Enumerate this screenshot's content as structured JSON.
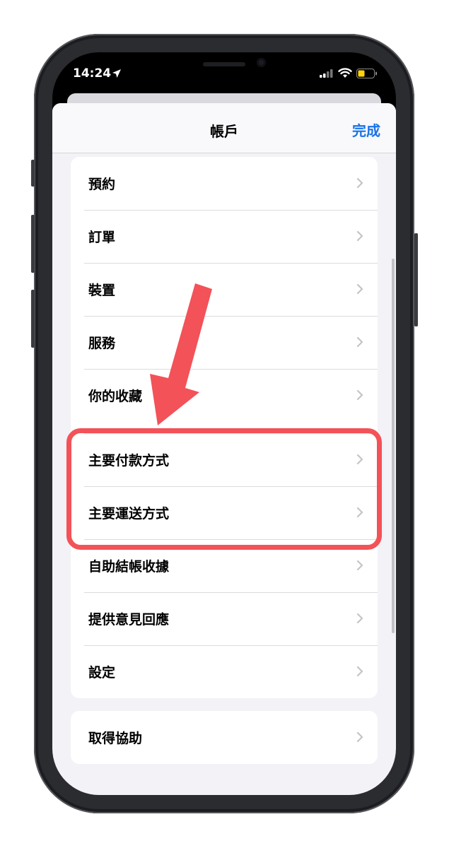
{
  "status": {
    "time": "14:24"
  },
  "nav": {
    "title": "帳戶",
    "done": "完成"
  },
  "groups": [
    {
      "items": [
        "預約",
        "訂單",
        "裝置",
        "服務",
        "你的收藏",
        "主要付款方式",
        "主要運送方式",
        "自助結帳收據",
        "提供意見回應",
        "設定"
      ]
    },
    {
      "items": [
        "取得協助"
      ]
    }
  ],
  "colors": {
    "accent": "#1a73e8",
    "annotation": "#f25258"
  }
}
